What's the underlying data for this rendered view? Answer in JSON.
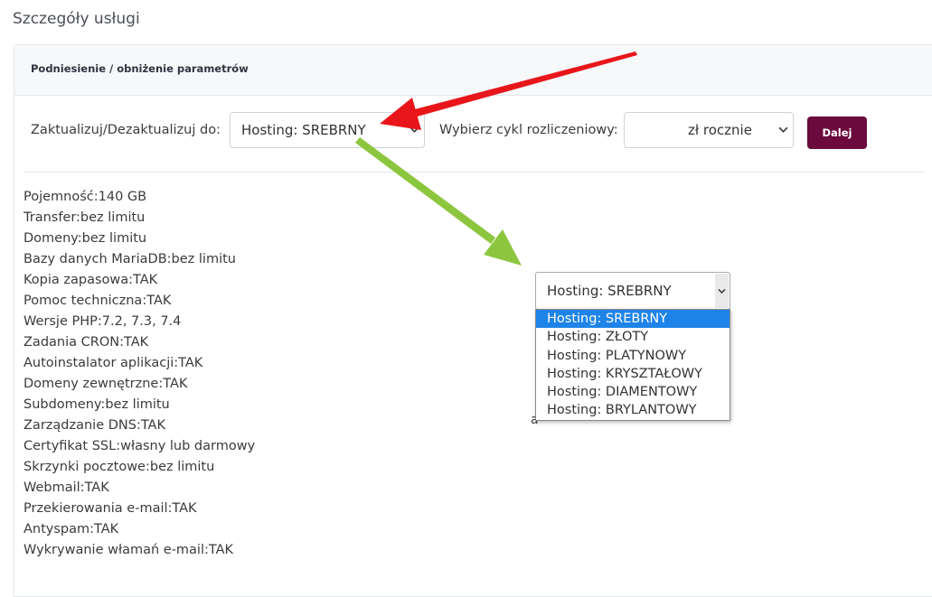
{
  "page": {
    "title": "Szczegóły usługi"
  },
  "panel": {
    "header_title": "Podniesienie / obniżenie parametrów"
  },
  "form": {
    "upgrade_label": "Zaktualizuj/Dezaktualizuj do:",
    "upgrade_value": "Hosting: SREBRNY",
    "billing_label": "Wybierz cykl rozliczeniowy:",
    "billing_value": "zł rocznie",
    "next_button": "Dalej"
  },
  "features": [
    "Pojemność:140 GB",
    "Transfer:bez limitu",
    "Domeny:bez limitu",
    "Bazy danych MariaDB:bez limitu",
    "Kopia zapasowa:TAK",
    "Pomoc techniczna:TAK",
    "Wersje PHP:7.2, 7.3, 7.4",
    "Zadania CRON:TAK",
    "Autoinstalator aplikacji:TAK",
    "Domeny zewnętrzne:TAK",
    "Subdomeny:bez limitu",
    "Zarządzanie DNS:TAK",
    "Certyfikat SSL:własny lub darmowy",
    "Skrzynki pocztowe:bez limitu",
    "Webmail:TAK",
    "Przekierowania e-mail:TAK",
    "Antyspam:TAK",
    "Wykrywanie włamań e-mail:TAK"
  ],
  "dropdown": {
    "selected": "Hosting: SREBRNY",
    "options": [
      "Hosting: SREBRNY",
      "Hosting: ZŁOTY",
      "Hosting: PLATYNOWY",
      "Hosting: KRYSZTAŁOWY",
      "Hosting: DIAMENTOWY",
      "Hosting: BRYLANTOWY"
    ],
    "highlighted_index": 0
  },
  "stray_text": "a",
  "colors": {
    "button_bg": "#6b0a3c",
    "highlight": "#1e84e8",
    "red_arrow": "#e8161b",
    "green_arrow": "#8cc63f"
  }
}
